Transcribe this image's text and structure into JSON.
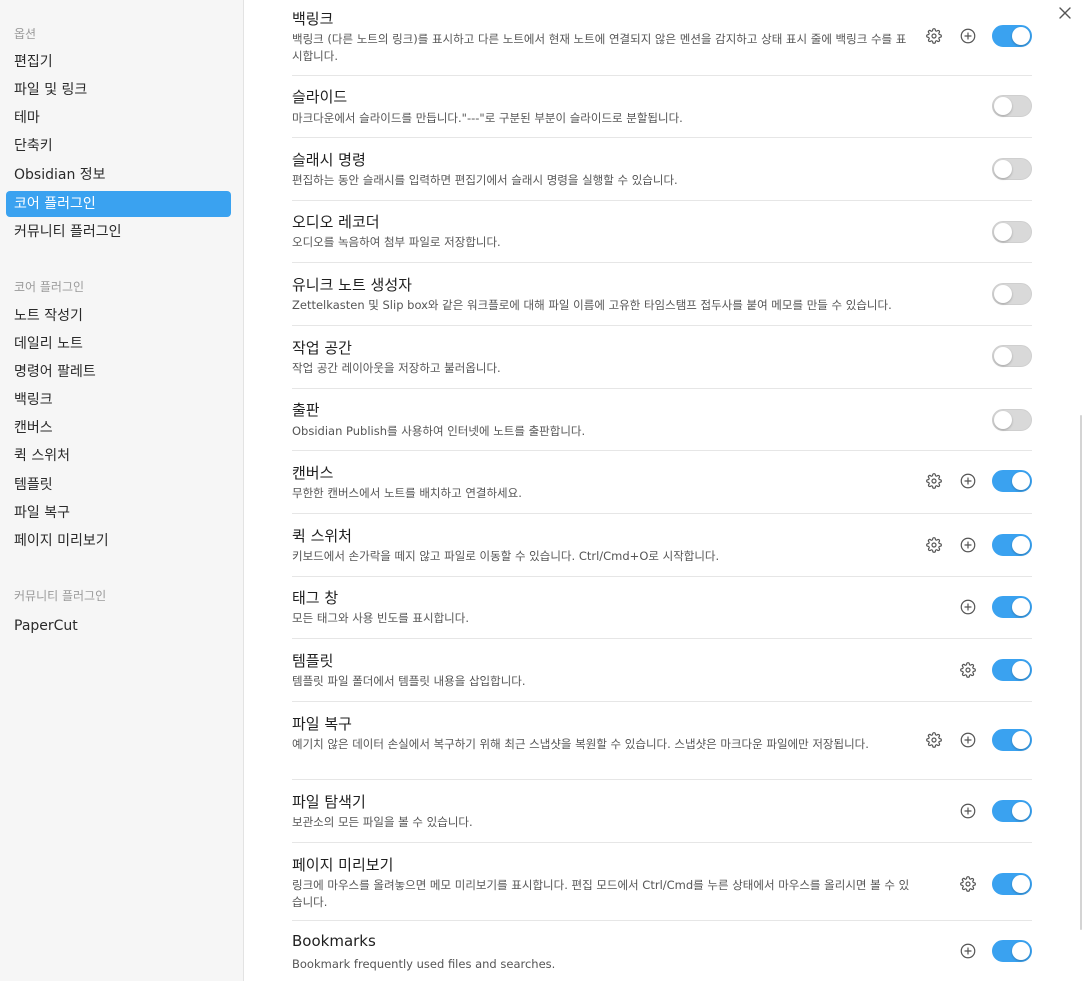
{
  "sidebar": {
    "options_heading": "옵션",
    "options": [
      "편집기",
      "파일 및 링크",
      "테마",
      "단축키",
      "Obsidian 정보",
      "코어 플러그인",
      "커뮤니티 플러그인"
    ],
    "active_option": "코어 플러그인",
    "core_heading": "코어 플러그인",
    "core": [
      "노트 작성기",
      "데일리 노트",
      "명령어 팔레트",
      "백링크",
      "캔버스",
      "퀵 스위처",
      "템플릿",
      "파일 복구",
      "페이지 미리보기"
    ],
    "community_heading": "커뮤니티 플러그인",
    "community": [
      "PaperCut"
    ]
  },
  "accent_color": "#3aa2f0",
  "plugins": [
    {
      "name": "백링크",
      "desc": "백링크 (다른 노트의 링크)를 표시하고 다른 노트에서 현재 노트에 연결되지 않은 멘션을 감지하고 상태 표시 줄에 백링크 수를 표시합니다.",
      "settings": true,
      "add": true,
      "enabled": true
    },
    {
      "name": "슬라이드",
      "desc": "마크다운에서 슬라이드를 만듭니다.\"---\"로 구분된 부분이 슬라이드로 분할됩니다.",
      "settings": false,
      "add": false,
      "enabled": false
    },
    {
      "name": "슬래시 명령",
      "desc": "편집하는 동안 슬래시를 입력하면 편집기에서 슬래시 명령을 실행할 수 있습니다.",
      "settings": false,
      "add": false,
      "enabled": false
    },
    {
      "name": "오디오 레코더",
      "desc": "오디오를 녹음하여 첨부 파일로 저장합니다.",
      "settings": false,
      "add": false,
      "enabled": false
    },
    {
      "name": "유니크 노트 생성자",
      "desc": "Zettelkasten 및 Slip box와 같은 워크플로에 대해 파일 이름에 고유한 타임스탬프 접두사를 붙여 메모를 만들 수 있습니다.",
      "settings": false,
      "add": false,
      "enabled": false
    },
    {
      "name": "작업 공간",
      "desc": "작업 공간 레이아웃을 저장하고 불러옵니다.",
      "settings": false,
      "add": false,
      "enabled": false
    },
    {
      "name": "출판",
      "desc": "Obsidian Publish를 사용하여 인터넷에 노트를 출판합니다.",
      "settings": false,
      "add": false,
      "enabled": false
    },
    {
      "name": "캔버스",
      "desc": "무한한 캔버스에서 노트를 배치하고 연결하세요.",
      "settings": true,
      "add": true,
      "enabled": true
    },
    {
      "name": "퀵 스위처",
      "desc": "키보드에서 손가락을 떼지 않고 파일로 이동할 수 있습니다. Ctrl/Cmd+O로 시작합니다.",
      "settings": true,
      "add": true,
      "enabled": true
    },
    {
      "name": "태그 창",
      "desc": "모든 태그와 사용 빈도를 표시합니다.",
      "settings": false,
      "add": true,
      "enabled": true
    },
    {
      "name": "템플릿",
      "desc": "템플릿 파일 폴더에서 템플릿 내용을 삽입합니다.",
      "settings": true,
      "add": false,
      "enabled": true
    },
    {
      "name": "파일 복구",
      "desc": "예기치 않은 데이터 손실에서 복구하기 위해 최근 스냅샷을 복원할 수 있습니다. 스냅샷은 마크다운 파일에만 저장됩니다.",
      "settings": true,
      "add": true,
      "enabled": true
    },
    {
      "name": "파일 탐색기",
      "desc": "보관소의 모든 파일을 볼 수 있습니다.",
      "settings": false,
      "add": true,
      "enabled": true
    },
    {
      "name": "페이지 미리보기",
      "desc": "링크에 마우스를 올려놓으면 메모 미리보기를 표시합니다. 편집 모드에서 Ctrl/Cmd를 누른 상태에서 마우스를 올리시면 볼 수 있습니다.",
      "settings": true,
      "add": false,
      "enabled": true
    },
    {
      "name": "Bookmarks",
      "desc": "Bookmark frequently used files and searches.",
      "settings": false,
      "add": true,
      "enabled": true
    }
  ]
}
